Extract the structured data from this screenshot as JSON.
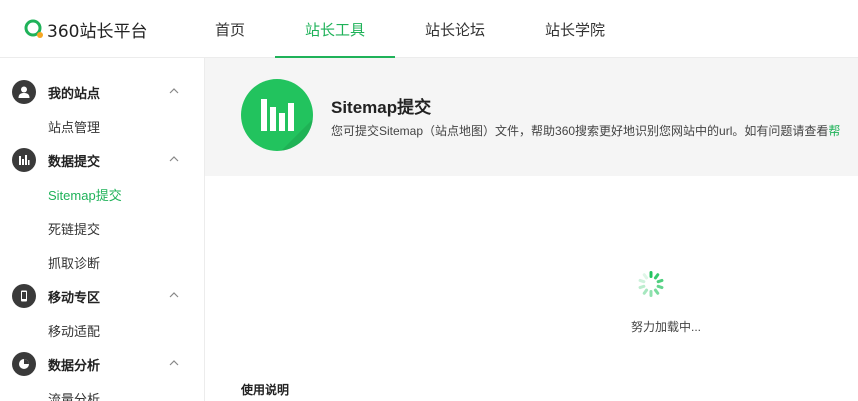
{
  "brand": {
    "name": "360站长平台",
    "accent": "#1fb259",
    "logo_orange": "#f5a623"
  },
  "nav": {
    "items": [
      {
        "label": "首页",
        "active": false
      },
      {
        "label": "站长工具",
        "active": true
      },
      {
        "label": "站长论坛",
        "active": false
      },
      {
        "label": "站长学院",
        "active": false
      }
    ]
  },
  "sidebar": {
    "groups": [
      {
        "label": "我的站点",
        "icon": "user-icon",
        "items": [
          "站点管理"
        ]
      },
      {
        "label": "数据提交",
        "icon": "bar-chart-icon",
        "items": [
          "Sitemap提交",
          "死链提交",
          "抓取诊断"
        ],
        "active_item": "Sitemap提交"
      },
      {
        "label": "移动专区",
        "icon": "mobile-icon",
        "items": [
          "移动适配"
        ]
      },
      {
        "label": "数据分析",
        "icon": "pie-chart-icon",
        "items": [
          "流量分析"
        ]
      }
    ]
  },
  "banner": {
    "title": "Sitemap提交",
    "description": "您可提交Sitemap（站点地图）文件，帮助360搜索更好地识别您网站中的url。如有问题请查看",
    "link_text": "帮"
  },
  "loading": {
    "text": "努力加载中..."
  },
  "usage": {
    "title": "使用说明"
  }
}
